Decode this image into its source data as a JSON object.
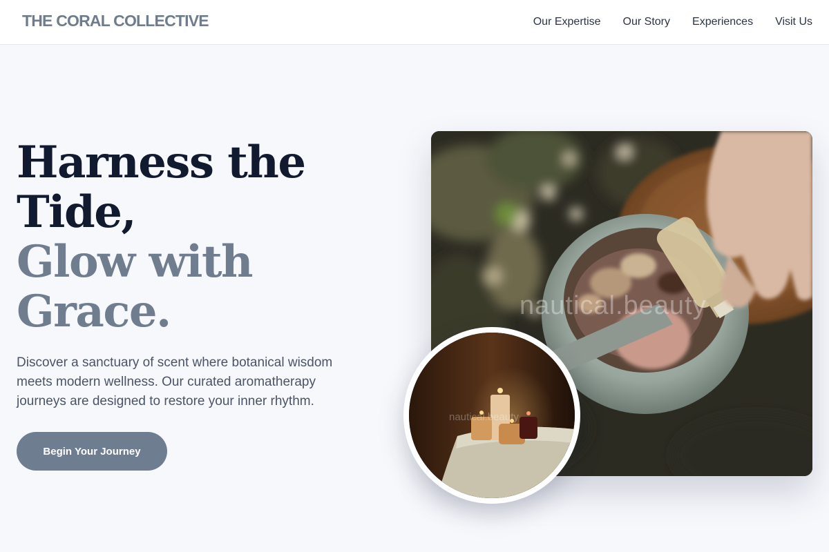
{
  "header": {
    "logo": "THE CORAL COLLECTIVE",
    "nav": [
      {
        "label": "Our Expertise"
      },
      {
        "label": "Our Story"
      },
      {
        "label": "Experiences"
      },
      {
        "label": "Visit Us"
      }
    ]
  },
  "hero": {
    "headline_line1": "Harness the",
    "headline_line2": "Tide,",
    "headline_line3": "Glow with",
    "headline_line4": "Grace.",
    "description": "Discover a sanctuary of scent where botanical wisdom meets modern wellness. Our curated aromatherapy journeys are designed to restore your inner rhythm.",
    "cta_label": "Begin Your Journey"
  },
  "images": {
    "main_watermark": "nautical.beauty",
    "inset_watermark": "nautical.beauty"
  },
  "colors": {
    "headline_dark": "#121a30",
    "headline_muted": "#6f7d8f",
    "cta_background": "#6f7d90",
    "logo": "#6f7c8e",
    "page_background": "#f7f8fc"
  }
}
